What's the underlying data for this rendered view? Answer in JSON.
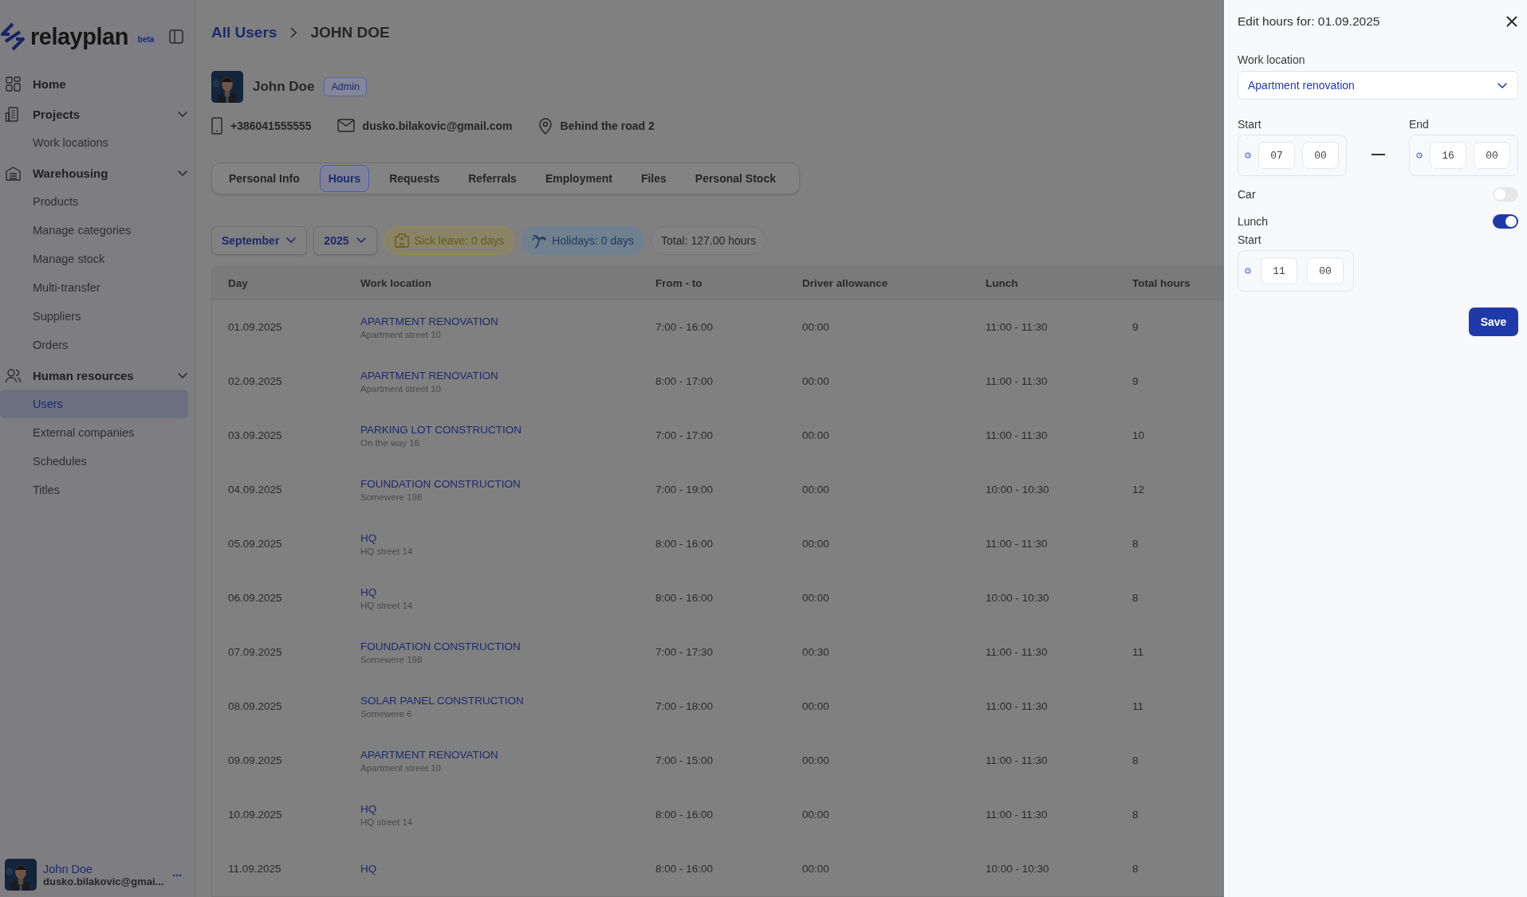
{
  "sidebar": {
    "logo": "relayplan",
    "badge": "beta",
    "sections": [
      {
        "label": "Home"
      },
      {
        "label": "Projects",
        "expanded": true,
        "children": [
          {
            "label": "Work locations",
            "selected": false
          }
        ]
      },
      {
        "label": "Warehousing",
        "expanded": true,
        "children": [
          {
            "label": "Products",
            "selected": false
          },
          {
            "label": "Manage categories",
            "selected": false
          },
          {
            "label": "Manage stock",
            "selected": false
          },
          {
            "label": "Multi-transfer",
            "selected": false
          },
          {
            "label": "Suppliers",
            "selected": false
          },
          {
            "label": "Orders",
            "selected": false
          }
        ]
      },
      {
        "label": "Human resources",
        "expanded": true,
        "children": [
          {
            "label": "Users",
            "selected": true
          },
          {
            "label": "External companies",
            "selected": false
          },
          {
            "label": "Schedules",
            "selected": false
          },
          {
            "label": "Titles",
            "selected": false
          }
        ]
      }
    ],
    "user": {
      "name": "John Doe",
      "email": "dusko.bilakovic@gmai...",
      "menu": "..."
    }
  },
  "breadcrumb": [
    "All Users",
    "JOHN DOE"
  ],
  "profile": {
    "name": "John Doe",
    "role": "Admin",
    "phone": "+386041555555",
    "email": "dusko.bilakovic@gmail.com",
    "address": "Behind the road 2"
  },
  "tabs": [
    {
      "label": "Personal Info",
      "selected": false
    },
    {
      "label": "Hours",
      "selected": true
    },
    {
      "label": "Requests",
      "selected": false
    },
    {
      "label": "Referrals",
      "selected": false
    },
    {
      "label": "Employment",
      "selected": false
    },
    {
      "label": "Files",
      "selected": false
    },
    {
      "label": "Personal Stock",
      "selected": false
    }
  ],
  "filters": {
    "month": "September",
    "year": "2025",
    "chips": [
      {
        "kind": "sick",
        "label": "Sick leave: 0 days"
      },
      {
        "kind": "holiday",
        "label": "Holidays: 0 days"
      },
      {
        "kind": "total",
        "label": "Total: 127.00 hours"
      }
    ]
  },
  "table": {
    "columns": [
      "Day",
      "Work location",
      "From - to",
      "Driver allowance",
      "Lunch",
      "Total hours"
    ],
    "rows": [
      {
        "day": "01.09.2025",
        "location": "APARTMENT RENOVATION",
        "address": "Apartment street 10",
        "from_to": "7:00 - 16:00",
        "driver": "00:00",
        "lunch": "11:00 - 11:30",
        "total": "9"
      },
      {
        "day": "02.09.2025",
        "location": "APARTMENT RENOVATION",
        "address": "Apartment street 10",
        "from_to": "8:00 - 17:00",
        "driver": "00:00",
        "lunch": "11:00 - 11:30",
        "total": "9"
      },
      {
        "day": "03.09.2025",
        "location": "PARKING LOT CONSTRUCTION",
        "address": "On the way 16",
        "from_to": "7:00 - 17:00",
        "driver": "00:00",
        "lunch": "11:00 - 11:30",
        "total": "10"
      },
      {
        "day": "04.09.2025",
        "location": "FOUNDATION CONSTRUCTION",
        "address": "Somewere 198",
        "from_to": "7:00 - 19:00",
        "driver": "00:00",
        "lunch": "10:00 - 10:30",
        "total": "12"
      },
      {
        "day": "05.09.2025",
        "location": "HQ",
        "address": "HQ street 14",
        "from_to": "8:00 - 16:00",
        "driver": "00:00",
        "lunch": "11:00 - 11:30",
        "total": "8"
      },
      {
        "day": "06.09.2025",
        "location": "HQ",
        "address": "HQ street 14",
        "from_to": "8:00 - 16:00",
        "driver": "00:00",
        "lunch": "10:00 - 10:30",
        "total": "8"
      },
      {
        "day": "07.09.2025",
        "location": "FOUNDATION CONSTRUCTION",
        "address": "Somewere 198",
        "from_to": "7:00 - 17:30",
        "driver": "00:30",
        "lunch": "11:00 - 11:30",
        "total": "11"
      },
      {
        "day": "08.09.2025",
        "location": "SOLAR PANEL CONSTRUCTION",
        "address": "Somewere 6",
        "from_to": "7:00 - 18:00",
        "driver": "00:00",
        "lunch": "11:00 - 11:30",
        "total": "11"
      },
      {
        "day": "09.09.2025",
        "location": "APARTMENT RENOVATION",
        "address": "Apartment street 10",
        "from_to": "7:00 - 15:00",
        "driver": "00:00",
        "lunch": "11:00 - 11:30",
        "total": "8"
      },
      {
        "day": "10.09.2025",
        "location": "HQ",
        "address": "HQ street 14",
        "from_to": "8:00 - 16:00",
        "driver": "00:00",
        "lunch": "11:00 - 11:30",
        "total": "8"
      },
      {
        "day": "11.09.2025",
        "location": "HQ",
        "from_to": "8:00 - 16:00",
        "driver": "00:00",
        "lunch": "10:00 - 10:30",
        "total": "8"
      }
    ]
  },
  "panel": {
    "title": "Edit hours for: 01.09.2025",
    "location_label": "Work location",
    "location": "Apartment renovation",
    "start_label": "Start",
    "start": {
      "hours": "07",
      "minutes": "00"
    },
    "end_label": "End",
    "end": {
      "hours": "16",
      "minutes": "00"
    },
    "toggles": [
      {
        "label": "Car",
        "on": false
      },
      {
        "label": "Lunch",
        "on": true
      }
    ],
    "lunch_start_label": "Start",
    "lunch_start": {
      "hours": "11",
      "minutes": "00"
    },
    "save": "Save"
  }
}
